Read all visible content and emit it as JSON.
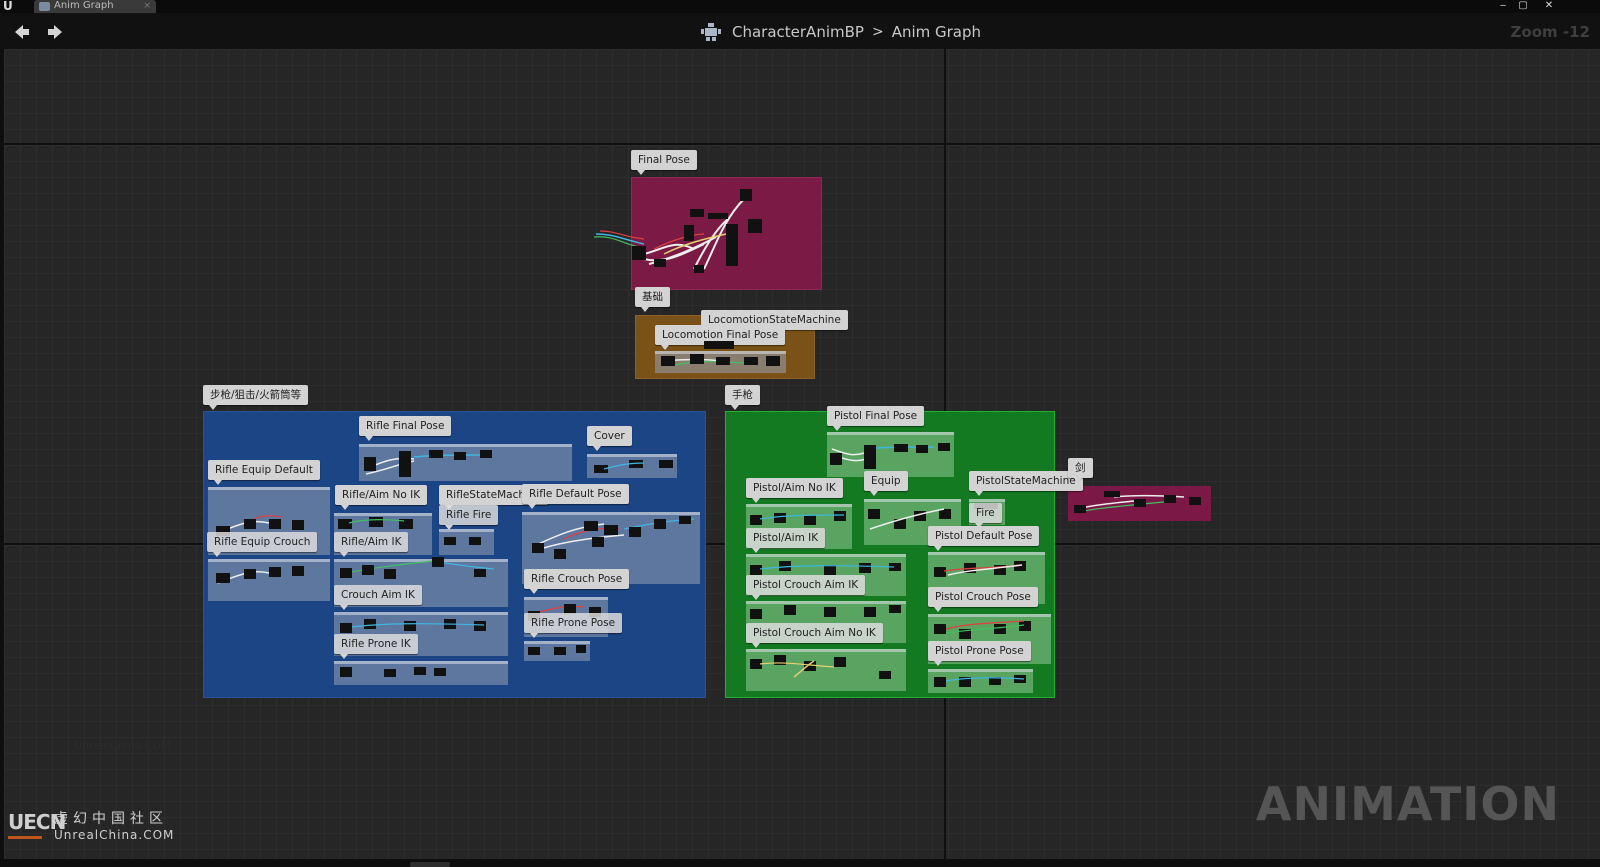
{
  "window": {
    "tab_label": "Anim Graph",
    "tab_close": "×",
    "minimize": "‒",
    "maximize": "▢",
    "close": "✕"
  },
  "toolbar": {
    "back_icon": "arrow-left-icon",
    "forward_icon": "arrow-right-icon",
    "breadcrumb": [
      "CharacterAnimBP",
      "Anim Graph"
    ],
    "breadcrumb_separator": ">",
    "zoom": "Zoom -12"
  },
  "colors": {
    "final_pose": "#7a1a45",
    "base": "#7a5217",
    "rifle": "#1b4585",
    "pistol": "#137a22",
    "sword": "#7c1846"
  },
  "comments": {
    "final_pose": "Final Pose",
    "base": "基础",
    "locomotion_sm": "LocomotionStateMachine",
    "locomotion_final": "Locomotion Final Pose",
    "rifle_group": "步枪/狙击/火箭筒等",
    "rifle_final": "Rifle Final Pose",
    "cover": "Cover",
    "rifle_equip_default": "Rifle Equip Default",
    "rifle_aim_no_ik": "Rifle/Aim No IK",
    "rifle_state_machine": "RifleStateMachine",
    "rifle_default_pose": "Rifle Default Pose",
    "rifle_fire": "Rifle Fire",
    "rifle_equip_crouch": "Rifle Equip Crouch",
    "rifle_aim_ik": "Rifle/Aim IK",
    "crouch_aim_ik": "Crouch Aim IK",
    "rifle_crouch_pose": "Rifle Crouch Pose",
    "rifle_prone_pose": "Rifle Prone Pose",
    "rifle_prone_ik": "Rifle Prone IK",
    "pistol_group": "手枪",
    "pistol_final": "Pistol Final Pose",
    "pistol_aim_no_ik": "Pistol/Aim No IK",
    "equip": "Equip",
    "pistol_state_machine": "PistolStateMachine",
    "fire": "Fire",
    "pistol_aim_ik": "Pistol/Aim IK",
    "pistol_default_pose": "Pistol Default Pose",
    "pistol_crouch_aim": "Pistol Crouch Aim IK",
    "pistol_crouch_pose": "Pistol Crouch Pose",
    "pistol_crouch_no_ik": "Pistol Crouch Aim No IK",
    "pistol_prone_pose": "Pistol Prone Pose",
    "sword_group": "剑"
  },
  "overlay": {
    "watermark": "UnrealChina.COM",
    "animation": "ANIMATION",
    "brand_logo": "UECN",
    "brand_cn": "虚幻中国社区",
    "brand_en": "UnrealChina.COM"
  }
}
